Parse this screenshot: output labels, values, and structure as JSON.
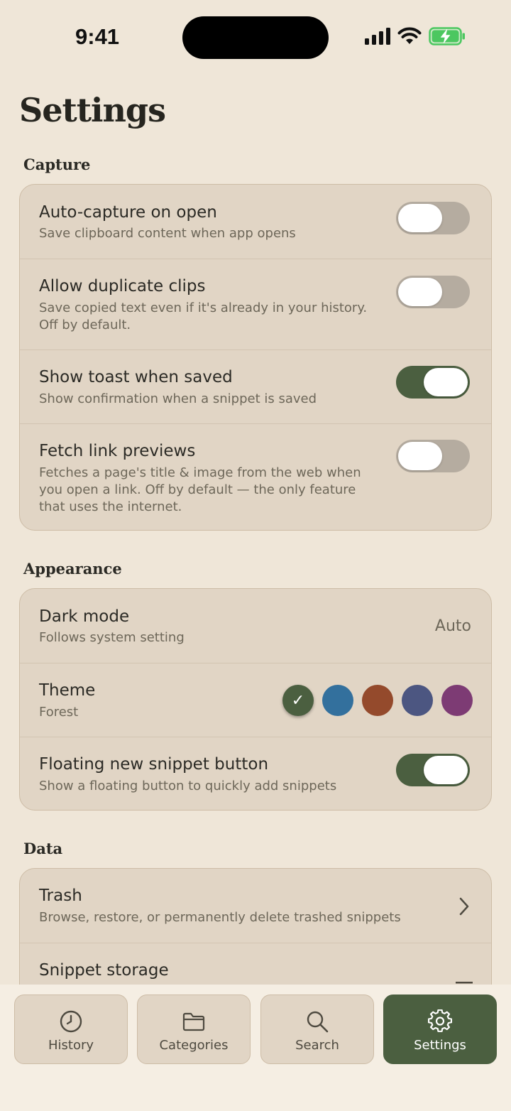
{
  "status_bar": {
    "time": "9:41"
  },
  "page": {
    "title": "Settings"
  },
  "sections": {
    "capture": {
      "title": "Capture",
      "rows": [
        {
          "title": "Auto-capture on open",
          "subtitle": [
            "Save clipboard content when app opens"
          ],
          "enabled": false
        },
        {
          "title": "Allow duplicate clips",
          "subtitle": [
            "Save copied text even if it's already in your history.",
            "Off by default."
          ],
          "enabled": false
        },
        {
          "title": "Show toast when saved",
          "subtitle": [
            "Show confirmation when a snippet is saved"
          ],
          "enabled": true
        },
        {
          "title": "Fetch link previews",
          "subtitle": [
            "Fetches a page's title & image from the web when",
            "you open a link. Off by default — the only feature",
            "that uses the internet."
          ],
          "enabled": false
        }
      ]
    },
    "appearance": {
      "title": "Appearance",
      "dark_mode": {
        "title": "Dark mode",
        "subtitle": "Follows system setting",
        "value": "Auto"
      },
      "theme": {
        "title": "Theme",
        "subtitle": "Forest",
        "swatches": [
          {
            "name": "Forest",
            "color": "#4b5f40",
            "selected": true
          },
          {
            "name": "blue",
            "color": "#33709d",
            "selected": false
          },
          {
            "name": "rust",
            "color": "#944a2c",
            "selected": false
          },
          {
            "name": "indigo",
            "color": "#4c5681",
            "selected": false
          },
          {
            "name": "plum",
            "color": "#7d3b74",
            "selected": false
          }
        ],
        "check_glyph": "✓"
      },
      "floating_button": {
        "title": "Floating new snippet button",
        "subtitle": "Show a floating button to quickly add snippets",
        "enabled": true
      }
    },
    "data": {
      "title": "Data",
      "trash": {
        "title": "Trash",
        "subtitle": "Browse, restore, or permanently delete trashed snippets",
        "icon": "chevron-right-icon"
      },
      "storage": {
        "title": "Snippet storage"
      }
    }
  },
  "tabs": [
    {
      "label": "History",
      "icon": "clock-icon",
      "active": false
    },
    {
      "label": "Categories",
      "icon": "folder-icon",
      "active": false
    },
    {
      "label": "Search",
      "icon": "search-icon",
      "active": false
    },
    {
      "label": "Settings",
      "icon": "gear-icon",
      "active": true
    }
  ],
  "colors": {
    "accent": "#4b5f40",
    "background": "#efe6d8",
    "card": "#e1d5c5",
    "toggle_off": "#b5aca0",
    "battery": "#4cc760"
  }
}
